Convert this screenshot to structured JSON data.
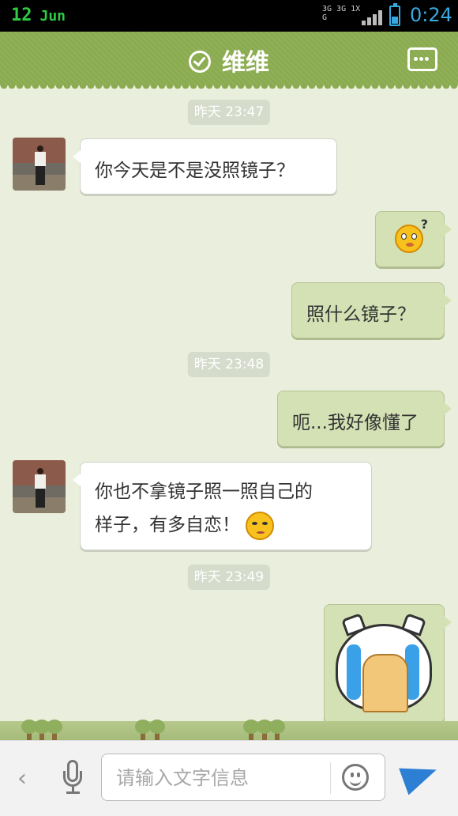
{
  "status_bar": {
    "day": "12",
    "month": "Jun",
    "network": "3G 3G 1X G",
    "time": "0:24"
  },
  "header": {
    "title": "维维",
    "icons": {
      "verified": "check-circle-icon",
      "more": "more-icon"
    }
  },
  "messages": [
    {
      "type": "timestamp",
      "text": "昨天 23:47"
    },
    {
      "type": "text",
      "side": "left",
      "text": "你今天是不是没照镜子？"
    },
    {
      "type": "emoji",
      "side": "right",
      "emoji": "confused-face-emoji"
    },
    {
      "type": "text",
      "side": "right",
      "text": "照什么镜子？"
    },
    {
      "type": "timestamp",
      "text": "昨天 23:48"
    },
    {
      "type": "text",
      "side": "right",
      "text": "呃...我好像懂了"
    },
    {
      "type": "text",
      "side": "left",
      "line1": "你也不拿镜子照一照自己的",
      "line2": "样子，有多自恋！",
      "emoji": "annoyed-face-emoji"
    },
    {
      "type": "timestamp",
      "text": "昨天 23:49"
    },
    {
      "type": "sticker",
      "side": "right",
      "sticker": "crying-cat-sticker"
    }
  ],
  "input_bar": {
    "placeholder": "请输入文字信息",
    "icons": [
      "back-icon",
      "mic-icon",
      "smile-icon",
      "send-icon"
    ]
  },
  "colors": {
    "header": "#8aab4f",
    "bg": "#e9efdc",
    "right_bubble": "#d4e1b4",
    "accent": "#38a9e0"
  }
}
